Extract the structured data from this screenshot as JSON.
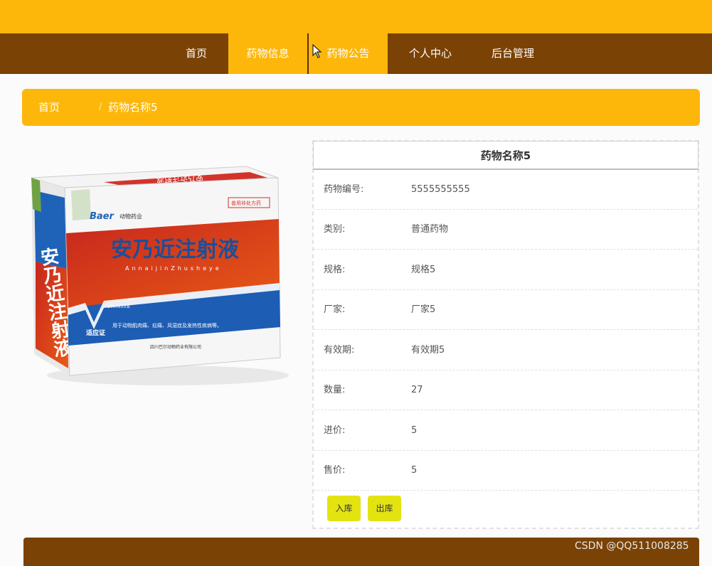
{
  "nav": {
    "items": [
      {
        "label": "首页"
      },
      {
        "label": "药物信息"
      },
      {
        "label": "药物公告"
      },
      {
        "label": "个人中心"
      },
      {
        "label": "后台管理"
      }
    ],
    "active_index": 1
  },
  "breadcrumb": {
    "home": "首页",
    "separator": "/",
    "current": "药物名称5"
  },
  "product": {
    "image": {
      "brand": "Baer",
      "brand_cn": "动物药业",
      "title": "安乃近注射液",
      "pinyin": "AnnaijinZhusheye",
      "spec": "10mlx10支",
      "indication_label": "适应证",
      "indication_text": "用于动物肌肉痛、疝痛、风湿症及发热性疾病等。",
      "manufacturer": "四川巴尔动物药业有限公司",
      "tag": "兽用非处方药",
      "side_text": "安乃近注射液"
    },
    "title": "药物名称5",
    "fields": [
      {
        "label": "药物编号:",
        "value": "5555555555"
      },
      {
        "label": "类别:",
        "value": "普通药物"
      },
      {
        "label": "规格:",
        "value": "规格5"
      },
      {
        "label": "厂家:",
        "value": "厂家5"
      },
      {
        "label": "有效期:",
        "value": "有效期5"
      },
      {
        "label": "数量:",
        "value": "27"
      },
      {
        "label": "进价:",
        "value": "5"
      },
      {
        "label": "售价:",
        "value": "5"
      }
    ],
    "buttons": {
      "stock_in": "入库",
      "stock_out": "出库"
    }
  },
  "watermark": "CSDN @QQ511008285",
  "colors": {
    "accent": "#fdb70a",
    "nav_bg": "#7a4205",
    "button": "#e3e312"
  }
}
